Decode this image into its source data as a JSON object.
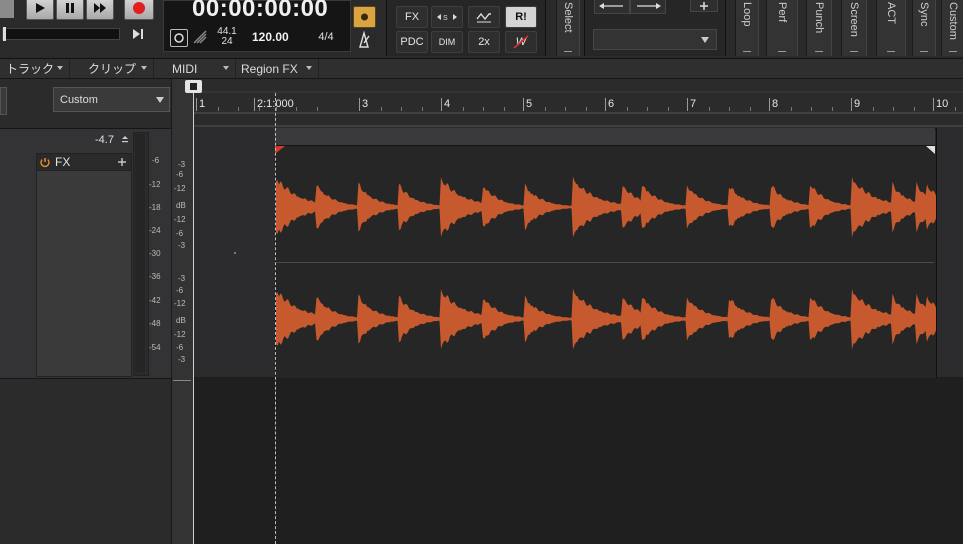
{
  "transport": {
    "timecode": "00:00:00:00",
    "sample_rate": "44.1",
    "bit_depth": "24",
    "tempo": "120.00",
    "meter": "4/4"
  },
  "mix_buttons": {
    "fx": "FX",
    "pdc": "PDC",
    "dim": "DIM",
    "two_x": "2x",
    "read_all": "R!",
    "w": "W"
  },
  "module_tabs": [
    "Select",
    "Loop",
    "Perf",
    "Punch",
    "Screen",
    "ACT",
    "Sync",
    "Custom"
  ],
  "menus": {
    "track": "トラック",
    "clip": "クリップ",
    "midi": "MIDI",
    "region_fx": "Region FX"
  },
  "view_preset": "Custom",
  "track": {
    "volume": "-4.7",
    "fx_label": "FX"
  },
  "meter_scale": [
    "-6",
    "-12",
    "-18",
    "-24",
    "-30",
    "-36",
    "-42",
    "-48",
    "-54"
  ],
  "clip_scale": [
    "-3",
    "-6",
    "-12",
    "dB",
    "-12",
    "-6",
    "-3"
  ],
  "ruler": {
    "marks": [
      "1",
      "2:1:000",
      "3",
      "4",
      "5",
      "6",
      "7",
      "8",
      "9",
      "10"
    ]
  },
  "waveform_color": "#c65a2e",
  "colors": {
    "background": "#1e1e1e",
    "record": "#e02020",
    "accent": "#f0a030"
  }
}
